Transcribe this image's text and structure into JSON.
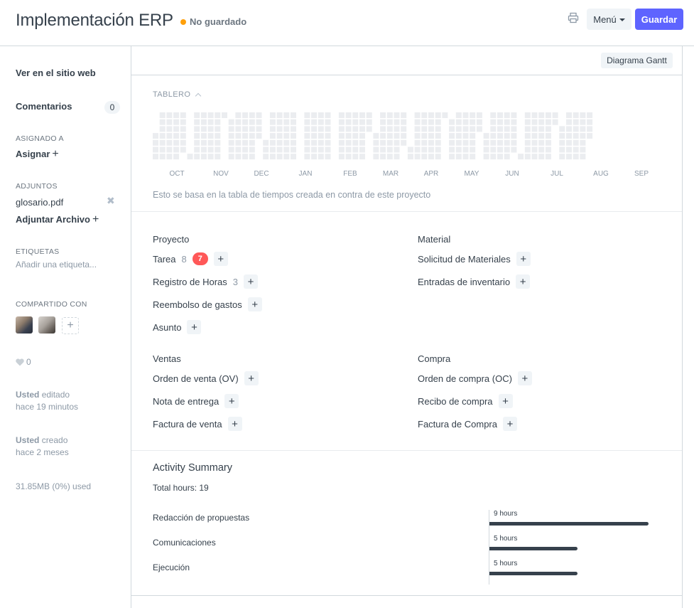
{
  "header": {
    "title": "Implementación ERP",
    "status": "No guardado",
    "status_color": "#ffa00a",
    "print_icon": "printer-icon",
    "menu_label": "Menú",
    "save_label": "Guardar",
    "accent": "#5e64ff"
  },
  "sidebar": {
    "view_site": "Ver en el sitio web",
    "comments_label": "Comentarios",
    "comments_count": "0",
    "assigned_label": "ASIGNADO A",
    "assign_action": "Asignar",
    "attachments_label": "ADJUNTOS",
    "attachment_file": "glosario.pdf",
    "attach_action": "Adjuntar Archivo",
    "tags_label": "ETIQUETAS",
    "tags_placeholder": "Añadir una etiqueta...",
    "shared_label": "COMPARTIDO CON",
    "likes_count": "0",
    "edited_user": "Usted",
    "edited_text": "editado",
    "edited_time": "hace 19 minutos",
    "created_user": "Usted",
    "created_text": "creado",
    "created_time": "hace 2 meses",
    "storage": "31.85MB (0%) used"
  },
  "main": {
    "gantt_button": "Diagrama Gantt",
    "dashboard_label": "TABLERO",
    "months": [
      "OCT",
      "NOV",
      "DEC",
      "JAN",
      "FEB",
      "MAR",
      "APR",
      "MAY",
      "JUN",
      "JUL",
      "AUG",
      "SEP"
    ],
    "dashboard_note": "Esto se basa en la tabla de tiempos creada en contra de este proyecto",
    "heatmap_empty_color": "#ebedf0",
    "groups": {
      "proyecto": {
        "title": "Proyecto",
        "items": [
          {
            "label": "Tarea",
            "count": "8",
            "open": "7"
          },
          {
            "label": "Registro de Horas",
            "count": "3"
          },
          {
            "label": "Reembolso de gastos"
          },
          {
            "label": "Asunto"
          }
        ]
      },
      "material": {
        "title": "Material",
        "items": [
          {
            "label": "Solicitud de Materiales"
          },
          {
            "label": "Entradas de inventario"
          }
        ]
      },
      "ventas": {
        "title": "Ventas",
        "items": [
          {
            "label": "Orden de venta (OV)"
          },
          {
            "label": "Nota de entrega"
          },
          {
            "label": "Factura de venta"
          }
        ]
      },
      "compra": {
        "title": "Compra",
        "items": [
          {
            "label": "Orden de compra (OC)"
          },
          {
            "label": "Recibo de compra"
          },
          {
            "label": "Factura de Compra"
          }
        ]
      }
    },
    "activity": {
      "title": "Activity Summary",
      "total": "Total hours: 19",
      "rows": [
        {
          "label": "Redacción de propuestas",
          "hours_text": "9 hours",
          "hours": 9
        },
        {
          "label": "Comunicaciones",
          "hours_text": "5 hours",
          "hours": 5
        },
        {
          "label": "Ejecución",
          "hours_text": "5 hours",
          "hours": 5
        }
      ]
    }
  }
}
